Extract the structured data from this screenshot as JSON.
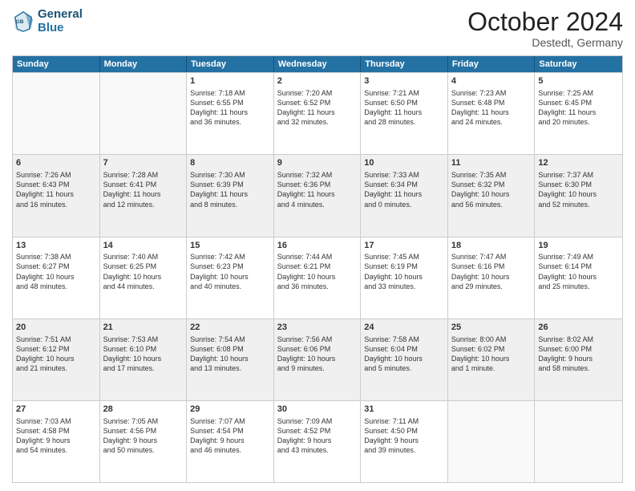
{
  "header": {
    "logo_line1": "General",
    "logo_line2": "Blue",
    "month": "October 2024",
    "location": "Destedt, Germany"
  },
  "weekdays": [
    "Sunday",
    "Monday",
    "Tuesday",
    "Wednesday",
    "Thursday",
    "Friday",
    "Saturday"
  ],
  "rows": [
    [
      {
        "day": "",
        "text": "",
        "empty": true
      },
      {
        "day": "",
        "text": "",
        "empty": true
      },
      {
        "day": "1",
        "text": "Sunrise: 7:18 AM\nSunset: 6:55 PM\nDaylight: 11 hours\nand 36 minutes."
      },
      {
        "day": "2",
        "text": "Sunrise: 7:20 AM\nSunset: 6:52 PM\nDaylight: 11 hours\nand 32 minutes."
      },
      {
        "day": "3",
        "text": "Sunrise: 7:21 AM\nSunset: 6:50 PM\nDaylight: 11 hours\nand 28 minutes."
      },
      {
        "day": "4",
        "text": "Sunrise: 7:23 AM\nSunset: 6:48 PM\nDaylight: 11 hours\nand 24 minutes."
      },
      {
        "day": "5",
        "text": "Sunrise: 7:25 AM\nSunset: 6:45 PM\nDaylight: 11 hours\nand 20 minutes."
      }
    ],
    [
      {
        "day": "6",
        "text": "Sunrise: 7:26 AM\nSunset: 6:43 PM\nDaylight: 11 hours\nand 16 minutes."
      },
      {
        "day": "7",
        "text": "Sunrise: 7:28 AM\nSunset: 6:41 PM\nDaylight: 11 hours\nand 12 minutes."
      },
      {
        "day": "8",
        "text": "Sunrise: 7:30 AM\nSunset: 6:39 PM\nDaylight: 11 hours\nand 8 minutes."
      },
      {
        "day": "9",
        "text": "Sunrise: 7:32 AM\nSunset: 6:36 PM\nDaylight: 11 hours\nand 4 minutes."
      },
      {
        "day": "10",
        "text": "Sunrise: 7:33 AM\nSunset: 6:34 PM\nDaylight: 11 hours\nand 0 minutes."
      },
      {
        "day": "11",
        "text": "Sunrise: 7:35 AM\nSunset: 6:32 PM\nDaylight: 10 hours\nand 56 minutes."
      },
      {
        "day": "12",
        "text": "Sunrise: 7:37 AM\nSunset: 6:30 PM\nDaylight: 10 hours\nand 52 minutes."
      }
    ],
    [
      {
        "day": "13",
        "text": "Sunrise: 7:38 AM\nSunset: 6:27 PM\nDaylight: 10 hours\nand 48 minutes."
      },
      {
        "day": "14",
        "text": "Sunrise: 7:40 AM\nSunset: 6:25 PM\nDaylight: 10 hours\nand 44 minutes."
      },
      {
        "day": "15",
        "text": "Sunrise: 7:42 AM\nSunset: 6:23 PM\nDaylight: 10 hours\nand 40 minutes."
      },
      {
        "day": "16",
        "text": "Sunrise: 7:44 AM\nSunset: 6:21 PM\nDaylight: 10 hours\nand 36 minutes."
      },
      {
        "day": "17",
        "text": "Sunrise: 7:45 AM\nSunset: 6:19 PM\nDaylight: 10 hours\nand 33 minutes."
      },
      {
        "day": "18",
        "text": "Sunrise: 7:47 AM\nSunset: 6:16 PM\nDaylight: 10 hours\nand 29 minutes."
      },
      {
        "day": "19",
        "text": "Sunrise: 7:49 AM\nSunset: 6:14 PM\nDaylight: 10 hours\nand 25 minutes."
      }
    ],
    [
      {
        "day": "20",
        "text": "Sunrise: 7:51 AM\nSunset: 6:12 PM\nDaylight: 10 hours\nand 21 minutes."
      },
      {
        "day": "21",
        "text": "Sunrise: 7:53 AM\nSunset: 6:10 PM\nDaylight: 10 hours\nand 17 minutes."
      },
      {
        "day": "22",
        "text": "Sunrise: 7:54 AM\nSunset: 6:08 PM\nDaylight: 10 hours\nand 13 minutes."
      },
      {
        "day": "23",
        "text": "Sunrise: 7:56 AM\nSunset: 6:06 PM\nDaylight: 10 hours\nand 9 minutes."
      },
      {
        "day": "24",
        "text": "Sunrise: 7:58 AM\nSunset: 6:04 PM\nDaylight: 10 hours\nand 5 minutes."
      },
      {
        "day": "25",
        "text": "Sunrise: 8:00 AM\nSunset: 6:02 PM\nDaylight: 10 hours\nand 1 minute."
      },
      {
        "day": "26",
        "text": "Sunrise: 8:02 AM\nSunset: 6:00 PM\nDaylight: 9 hours\nand 58 minutes."
      }
    ],
    [
      {
        "day": "27",
        "text": "Sunrise: 7:03 AM\nSunset: 4:58 PM\nDaylight: 9 hours\nand 54 minutes."
      },
      {
        "day": "28",
        "text": "Sunrise: 7:05 AM\nSunset: 4:56 PM\nDaylight: 9 hours\nand 50 minutes."
      },
      {
        "day": "29",
        "text": "Sunrise: 7:07 AM\nSunset: 4:54 PM\nDaylight: 9 hours\nand 46 minutes."
      },
      {
        "day": "30",
        "text": "Sunrise: 7:09 AM\nSunset: 4:52 PM\nDaylight: 9 hours\nand 43 minutes."
      },
      {
        "day": "31",
        "text": "Sunrise: 7:11 AM\nSunset: 4:50 PM\nDaylight: 9 hours\nand 39 minutes."
      },
      {
        "day": "",
        "text": "",
        "empty": true
      },
      {
        "day": "",
        "text": "",
        "empty": true
      }
    ]
  ]
}
